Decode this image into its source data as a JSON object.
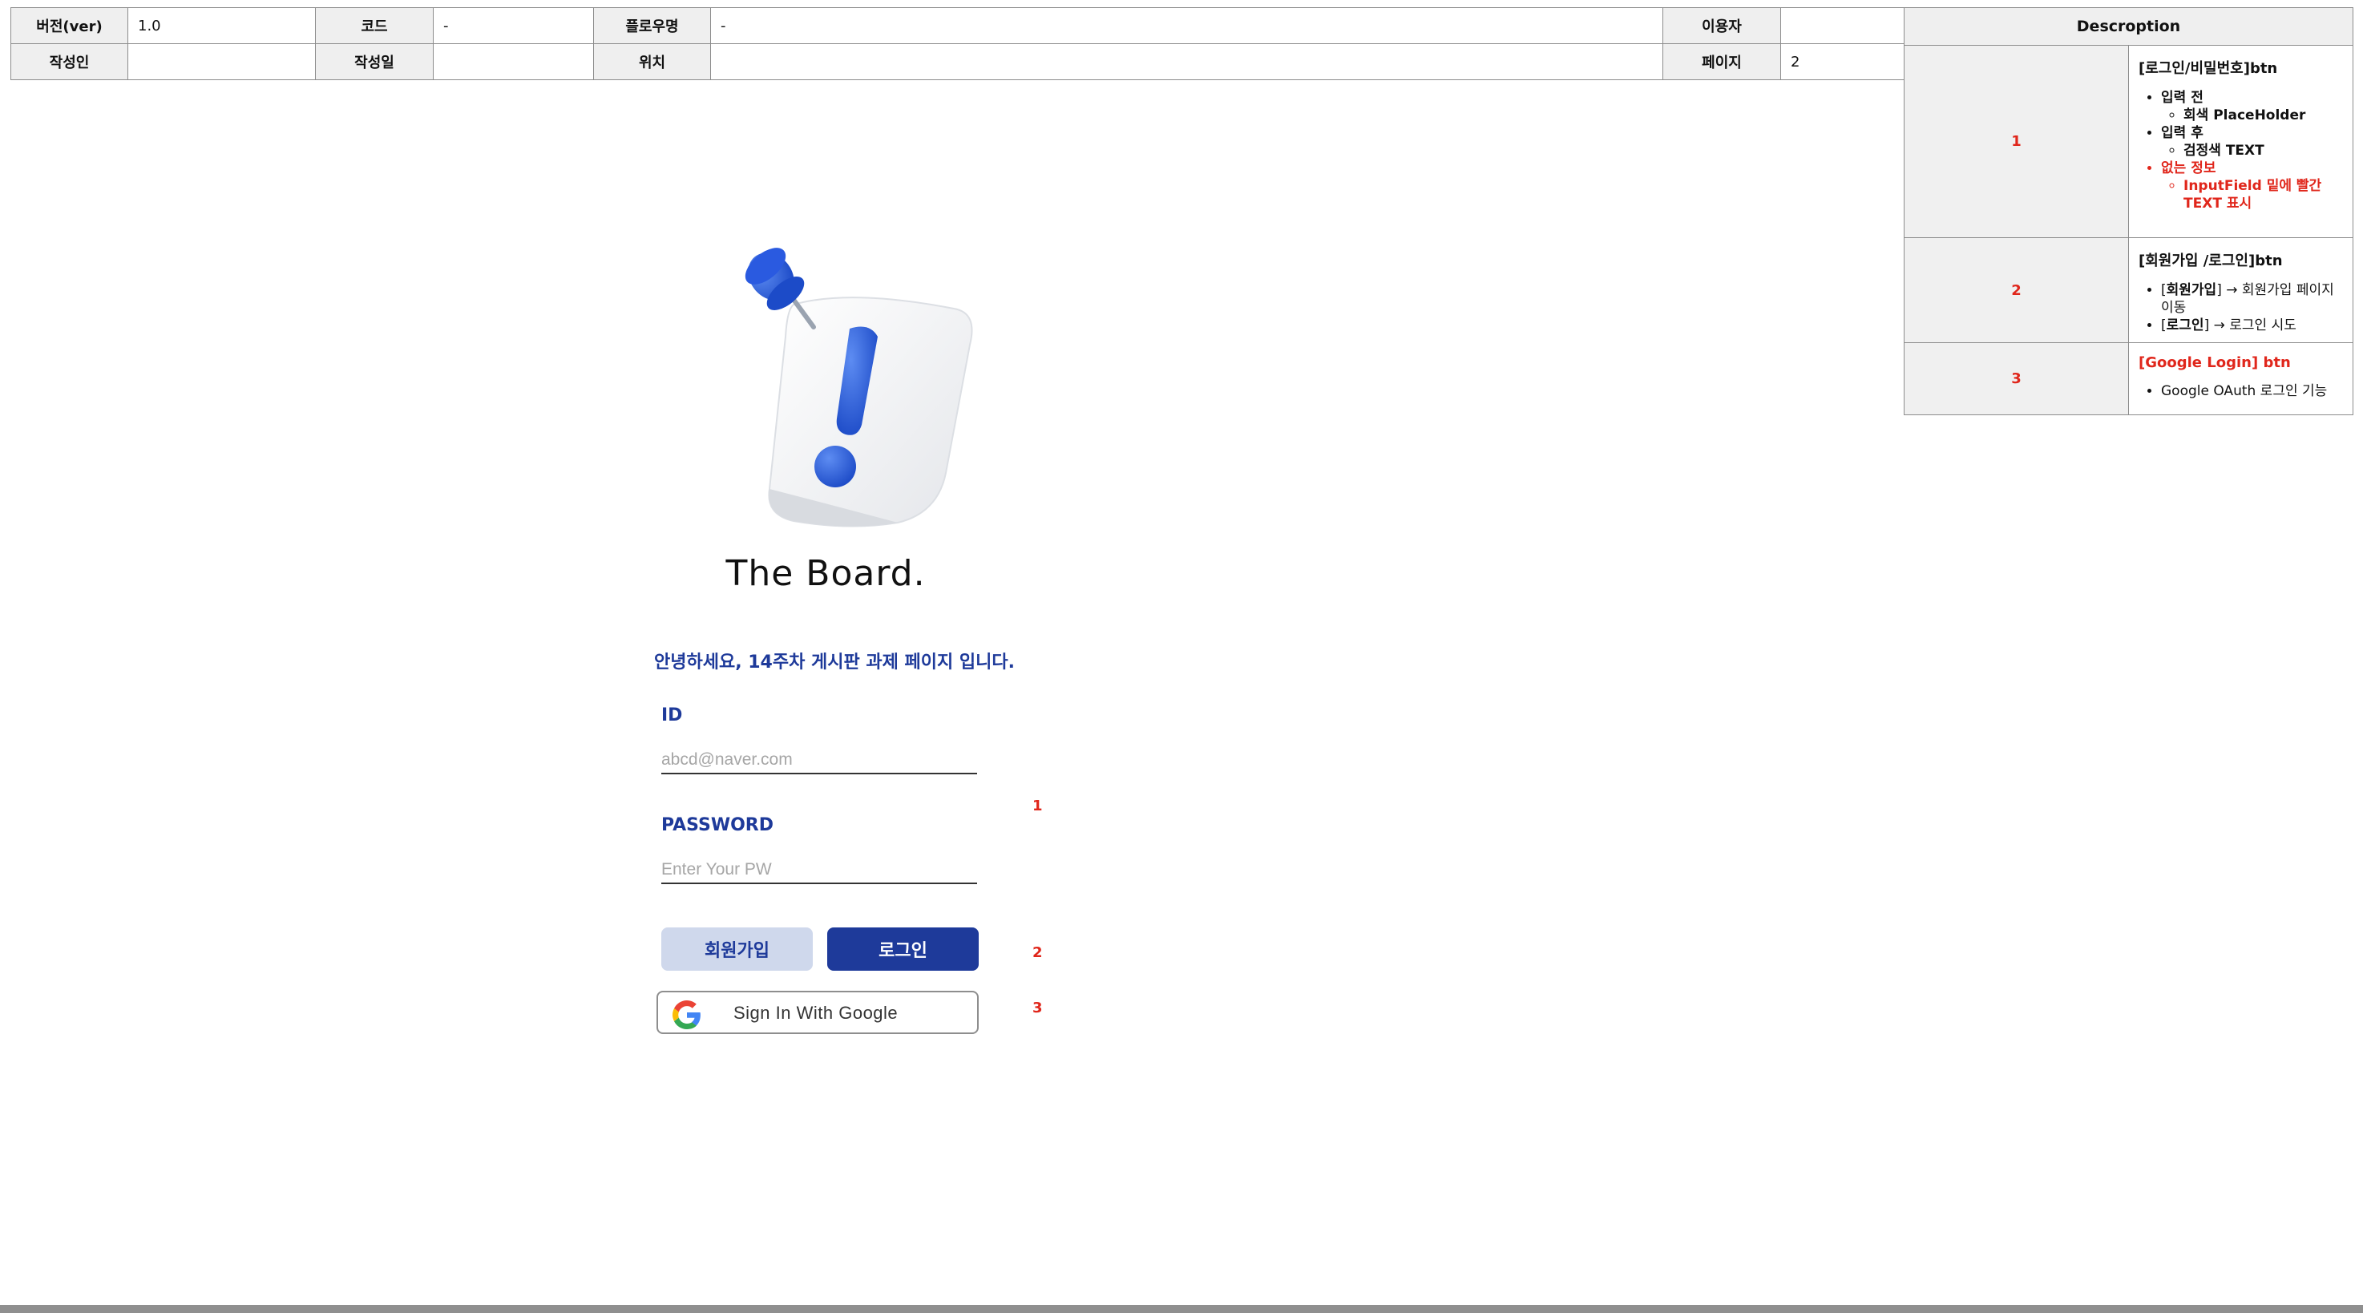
{
  "meta": {
    "version_label": "버전(ver)",
    "version": "1.0",
    "code_label": "코드",
    "code": "-",
    "flow_label": "플로우명",
    "flow": "-",
    "user_label": "이용자",
    "user": "",
    "author_label": "작성인",
    "author": "",
    "date_label": "작성일",
    "date": "",
    "location_label": "위치",
    "location": "",
    "page_label": "페이지",
    "page": "2"
  },
  "description": {
    "header": "Descroption",
    "items": [
      {
        "num": "1",
        "title": "[로그인/비밀번호]btn",
        "before": "입력 전",
        "before_sub": "회색 PlaceHolder",
        "after": "입력 후",
        "after_sub": "검정색 TEXT",
        "missing": "없는 정보",
        "missing_sub": "InputField 밑에 빨간 TEXT 표시"
      },
      {
        "num": "2",
        "title": "[회원가입 /로그인]btn",
        "signup_bold": "회원가입",
        "signup_rest": "] → 회원가입 페이지 이동",
        "login_bold": "로그인",
        "login_rest": "] → 로그인 시도",
        "bracket": "["
      },
      {
        "num": "3",
        "title": "[Google Login] btn",
        "bullet": "Google OAuth 로그인 기능"
      }
    ]
  },
  "login": {
    "brand": "The Board.",
    "greeting": "안녕하세요, 14주차 게시판 과제 페이지 입니다.",
    "id_label": "ID",
    "id_placeholder": "abcd@naver.com",
    "pw_label": "PASSWORD",
    "pw_placeholder": "Enter Your PW",
    "signup_label": "회원가입",
    "login_label": "로그인",
    "google_label": "Sign In With Google",
    "markers": [
      "1",
      "2",
      "3"
    ]
  },
  "colors": {
    "accent": "#1e3a9a",
    "accent_light": "#cfd8ec",
    "annotation": "#e0261b"
  }
}
